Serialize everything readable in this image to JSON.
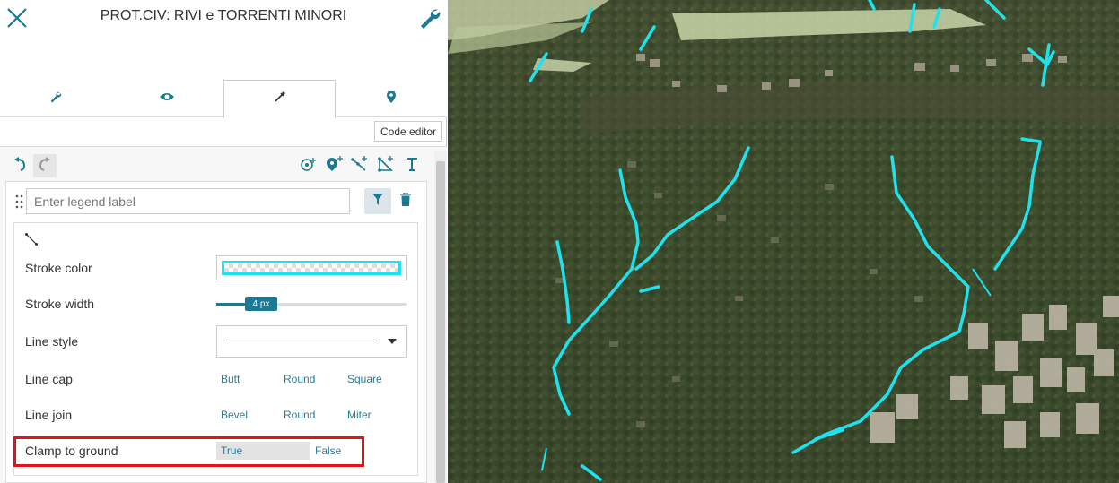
{
  "panel": {
    "title": "PROT.CIV: RIVI e TORRENTI MINORI",
    "code_editor_label": "Code editor",
    "tabs": [
      {
        "icon": "wrench-icon"
      },
      {
        "icon": "eye-icon"
      },
      {
        "icon": "eyedropper-icon",
        "active": true
      },
      {
        "icon": "map-marker-icon"
      }
    ]
  },
  "legend": {
    "placeholder": "Enter legend label"
  },
  "style": {
    "stroke_color_label": "Stroke color",
    "stroke_color_value": "#1ee3ee",
    "stroke_width_label": "Stroke width",
    "stroke_width_value": "4 px",
    "line_style_label": "Line style",
    "line_cap_label": "Line cap",
    "line_cap_options": [
      "Butt",
      "Round",
      "Square"
    ],
    "line_join_label": "Line join",
    "line_join_options": [
      "Bevel",
      "Round",
      "Miter"
    ],
    "clamp_label": "Clamp to ground",
    "clamp_options": [
      "True",
      "False"
    ],
    "clamp_selected": "True"
  },
  "colors": {
    "accent": "#1b7a91",
    "link": "#2b7b92",
    "highlight": "#e0141c",
    "river": "#1ee3ee"
  }
}
